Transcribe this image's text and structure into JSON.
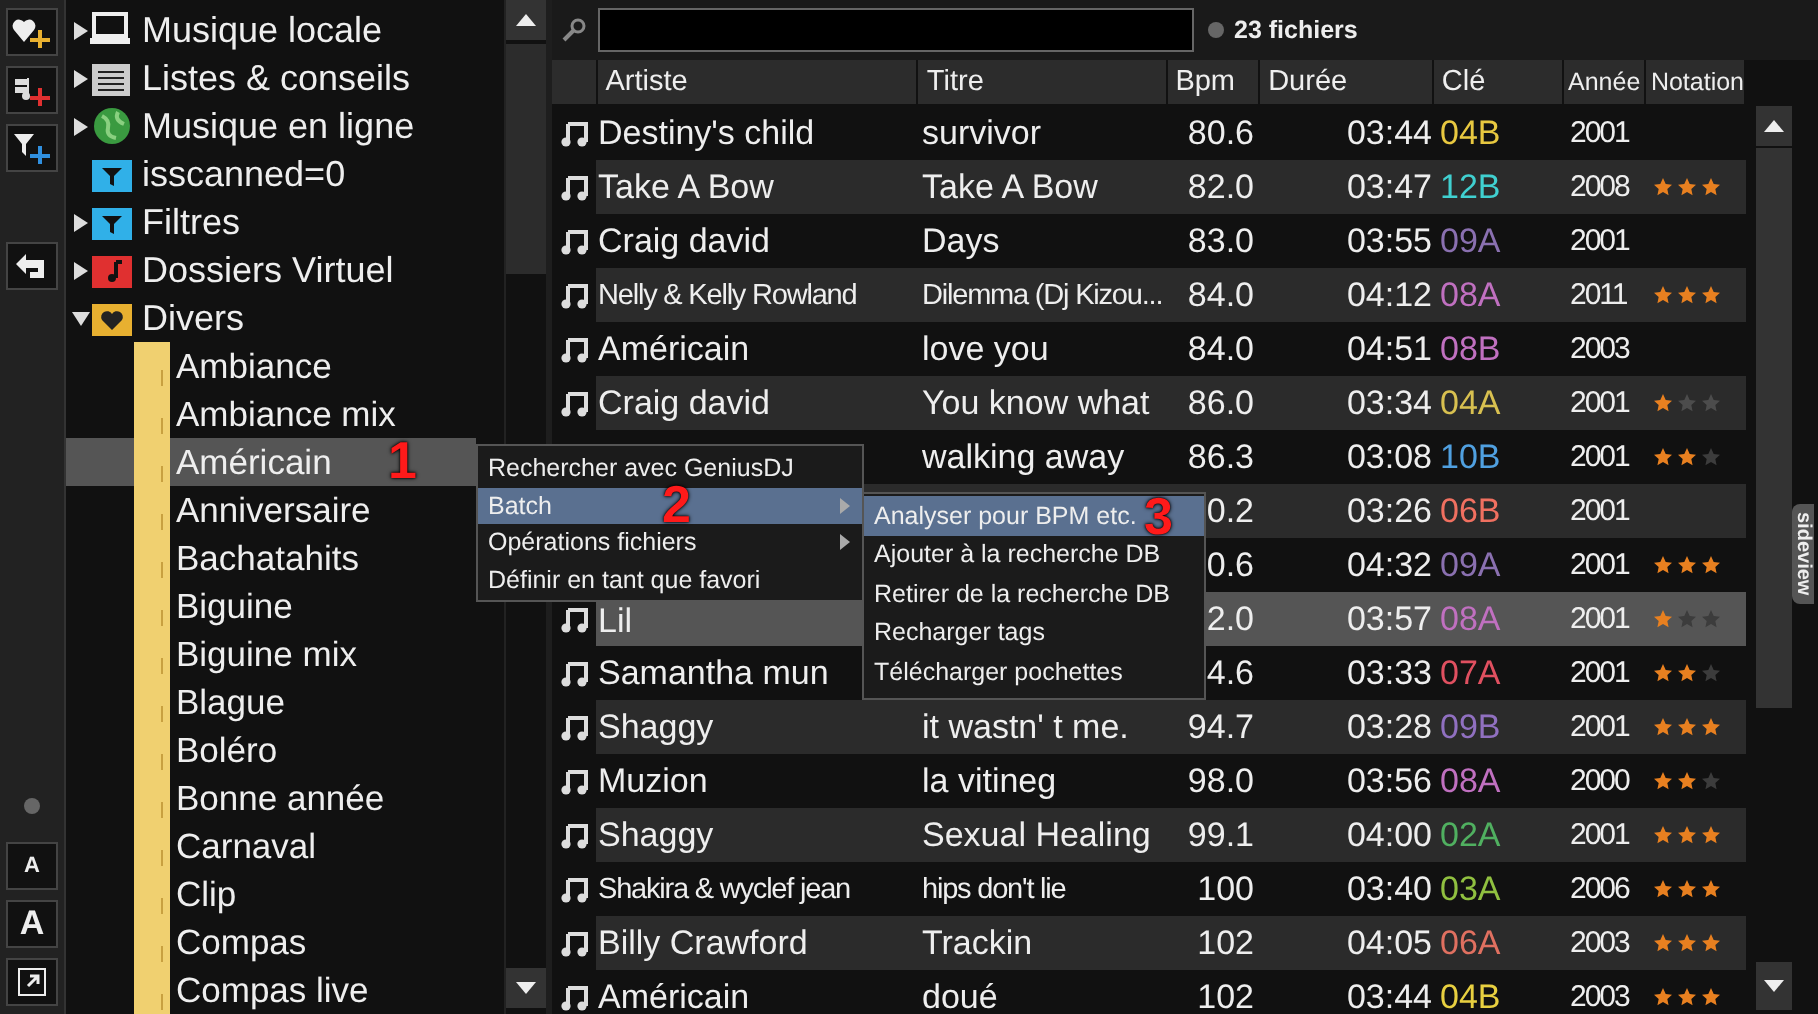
{
  "toolbar": {
    "text_buttons": [
      "A",
      "A"
    ]
  },
  "tree": [
    {
      "label": "Musique locale",
      "kind": "computer",
      "expanded": false
    },
    {
      "label": "Listes & conseils",
      "kind": "list",
      "expanded": false
    },
    {
      "label": "Musique en ligne",
      "kind": "globe",
      "expanded": false
    },
    {
      "label": "isscanned=0",
      "kind": "filter"
    },
    {
      "label": "Filtres",
      "kind": "filter",
      "expanded": false
    },
    {
      "label": "Dossiers Virtuel",
      "kind": "virtual",
      "expanded": false
    },
    {
      "label": "Divers",
      "kind": "heart",
      "expanded": true,
      "children": [
        {
          "label": "Ambiance",
          "selected": false
        },
        {
          "label": "Ambiance mix",
          "selected": false
        },
        {
          "label": "Américain",
          "selected": true,
          "annotation": "1"
        },
        {
          "label": "Anniversaire",
          "selected": false
        },
        {
          "label": "Bachatahits",
          "selected": false
        },
        {
          "label": "Biguine",
          "selected": false
        },
        {
          "label": "Biguine mix",
          "selected": false
        },
        {
          "label": "Blague",
          "selected": false
        },
        {
          "label": "Boléro",
          "selected": false
        },
        {
          "label": "Bonne année",
          "selected": false
        },
        {
          "label": "Carnaval",
          "selected": false
        },
        {
          "label": "Clip",
          "selected": false
        },
        {
          "label": "Compas",
          "selected": false
        },
        {
          "label": "Compas live",
          "selected": false
        }
      ]
    }
  ],
  "search": {
    "count": "23 fichiers"
  },
  "table": {
    "columns": [
      "Artiste",
      "Titre",
      "Bpm",
      "Durée",
      "Clé",
      "Année",
      "Notation"
    ],
    "rows": [
      {
        "artist": "Destiny's child",
        "title": "survivor",
        "bpm": "80.6",
        "duration": "03:44",
        "key": "04B",
        "color": "#e8c840",
        "year": "2001",
        "narrow": false,
        "selected": false
      },
      {
        "artist": "Take A Bow",
        "title": "Take A Bow",
        "bpm": "82.0",
        "duration": "03:47",
        "key": "12B",
        "color": "#40d0d0",
        "year": "2008",
        "stars": 3,
        "narrow": false,
        "selected": false
      },
      {
        "artist": "Craig david",
        "title": "Days",
        "bpm": "83.0",
        "duration": "03:55",
        "key": "09A",
        "color": "#8a70b0",
        "year": "2001",
        "narrow": false,
        "selected": false
      },
      {
        "artist": "Nelly & Kelly Rowland",
        "title": "Dilemma (Dj Kizou...",
        "bpm": "84.0",
        "duration": "04:12",
        "key": "08A",
        "color": "#c070c0",
        "year": "2011",
        "stars": 3,
        "narrow": true,
        "selected": false
      },
      {
        "artist": "Américain",
        "title": "love you",
        "bpm": "84.0",
        "duration": "04:51",
        "key": "08B",
        "color": "#c070c0",
        "year": "2003",
        "narrow": false,
        "selected": false
      },
      {
        "artist": "Craig david",
        "title": "You know what",
        "bpm": "86.0",
        "duration": "03:34",
        "key": "04A",
        "color": "#d8c050",
        "year": "2001",
        "stars": 1,
        "narrow": false,
        "selected": false
      },
      {
        "title": "walking away",
        "bpm": "86.3",
        "duration": "03:08",
        "key": "10B",
        "color": "#50a0e0",
        "year": "2001",
        "stars": 2,
        "narrow": false,
        "selected": false
      },
      {
        "bpm": "0.2",
        "duration": "03:26",
        "key": "06B",
        "color": "#f07060",
        "year": "2001",
        "selected": false
      },
      {
        "bpm": "0.6",
        "duration": "04:32",
        "key": "09A",
        "color": "#8a70b0",
        "year": "2001",
        "stars": 3,
        "selected": false
      },
      {
        "artist": "Lil",
        "bpm": "2.0",
        "duration": "03:57",
        "key": "08A",
        "color": "#c070c0",
        "year": "2001",
        "stars": 1,
        "narrow": false,
        "selected": true
      },
      {
        "artist": "Samantha mun",
        "bpm": "4.6",
        "duration": "03:33",
        "key": "07A",
        "color": "#e05060",
        "year": "2001",
        "stars": 2,
        "narrow": false,
        "selected": false
      },
      {
        "artist": "Shaggy",
        "title": "it wastn' t me.",
        "bpm": "94.7",
        "duration": "03:28",
        "key": "09B",
        "color": "#9070c0",
        "year": "2001",
        "stars": 3,
        "narrow": false,
        "selected": false
      },
      {
        "artist": "Muzion",
        "title": "la vitineg",
        "bpm": "98.0",
        "duration": "03:56",
        "key": "08A",
        "color": "#c070c0",
        "year": "2000",
        "stars": 2,
        "narrow": false,
        "selected": false
      },
      {
        "artist": "Shaggy",
        "title": "Sexual Healing",
        "bpm": "99.1",
        "duration": "04:00",
        "key": "02A",
        "color": "#50b060",
        "year": "2001",
        "stars": 3,
        "narrow": false,
        "selected": false
      },
      {
        "artist": "Shakira & wyclef jean",
        "title": "hips don't lie",
        "bpm": "100",
        "duration": "03:40",
        "key": "03A",
        "color": "#90c040",
        "year": "2006",
        "stars": 3,
        "narrow": true,
        "selected": false
      },
      {
        "artist": "Billy Crawford",
        "title": "Trackin",
        "bpm": "102",
        "duration": "04:05",
        "key": "06A",
        "color": "#e07060",
        "year": "2003",
        "stars": 3,
        "narrow": false,
        "selected": false
      },
      {
        "artist": "Américain",
        "title": "doué",
        "bpm": "102",
        "duration": "03:44",
        "key": "04B",
        "color": "#e8d040",
        "year": "2003",
        "stars": 3,
        "narrow": false,
        "selected": false
      }
    ]
  },
  "sideview_tab": "sideview",
  "context_menu": [
    {
      "label": "Rechercher avec GeniusDJ",
      "submenu": false,
      "selected": false
    },
    {
      "label": "Batch",
      "submenu": true,
      "selected": true,
      "annotation": "2"
    },
    {
      "label": "Opérations fichiers",
      "submenu": true,
      "selected": false
    },
    {
      "label": "Définir en tant que favori",
      "submenu": false,
      "selected": false
    }
  ],
  "submenu": [
    {
      "label": "Analyser pour BPM etc.",
      "selected": true,
      "annotation": "3"
    },
    {
      "label": "Ajouter à la recherche DB",
      "selected": false
    },
    {
      "label": "Retirer de la recherche DB",
      "selected": false
    },
    {
      "label": "Recharger tags",
      "selected": false
    },
    {
      "label": "Télécharger pochettes",
      "selected": false
    }
  ]
}
